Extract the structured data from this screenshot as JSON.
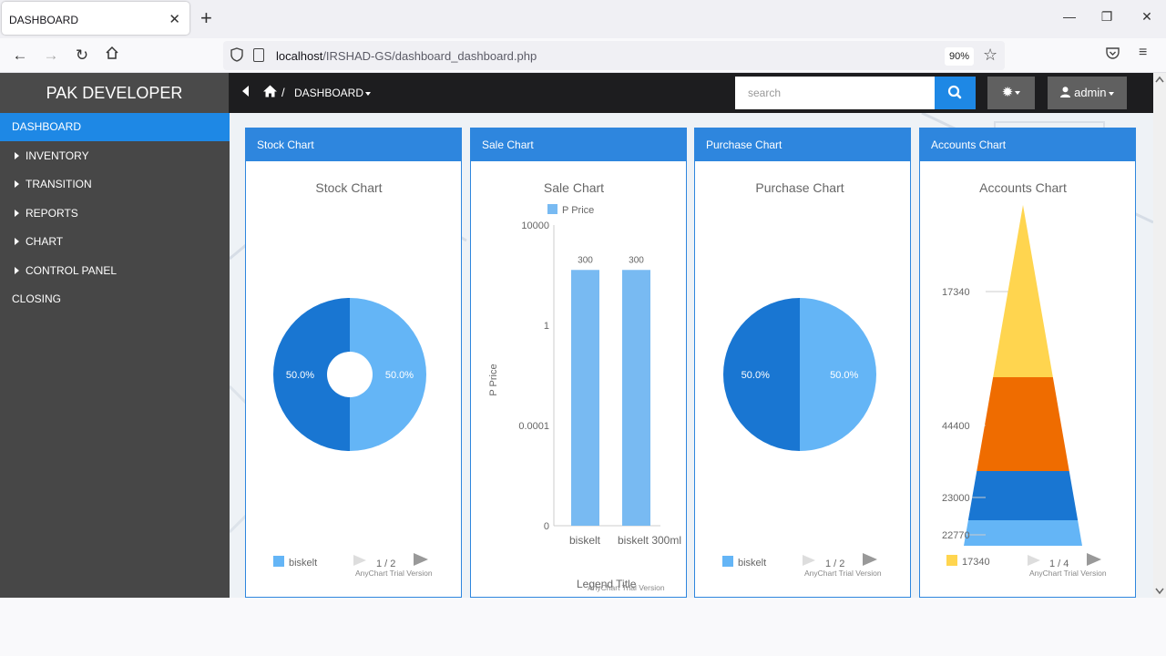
{
  "browser": {
    "tab_title": "DASHBOARD",
    "url_host": "localhost",
    "url_path": "/IRSHAD-GS/dashboard_dashboard.php",
    "zoom": "90%"
  },
  "header": {
    "brand": "PAK DEVELOPER",
    "breadcrumb_sep": "/",
    "breadcrumb": "DASHBOARD",
    "search_placeholder": "search",
    "user": "admin"
  },
  "sidebar": {
    "items": [
      {
        "label": "DASHBOARD",
        "active": true,
        "expandable": false
      },
      {
        "label": "INVENTORY",
        "active": false,
        "expandable": true
      },
      {
        "label": "TRANSITION",
        "active": false,
        "expandable": true
      },
      {
        "label": "REPORTS",
        "active": false,
        "expandable": true
      },
      {
        "label": "CHART",
        "active": false,
        "expandable": true
      },
      {
        "label": "CONTROL PANEL",
        "active": false,
        "expandable": true
      },
      {
        "label": "CLOSING",
        "active": false,
        "expandable": false
      }
    ]
  },
  "cards": {
    "stock": {
      "header": "Stock Chart",
      "title": "Stock Chart",
      "legend": "biskelt",
      "pager": "1 / 2",
      "watermark": "AnyChart Trial Version"
    },
    "sale": {
      "header": "Sale Chart",
      "title": "Sale Chart",
      "legend": "P Price",
      "ylabel": "P Price",
      "legend_title": "Legend Title",
      "watermark": "AnyChart Trial Version"
    },
    "purchase": {
      "header": "Purchase Chart",
      "title": "Purchase Chart",
      "legend": "biskelt",
      "pager": "1 / 2",
      "watermark": "AnyChart Trial Version"
    },
    "accounts": {
      "header": "Accounts Chart",
      "title": "Accounts Chart",
      "legend": "17340",
      "pager": "1 / 4",
      "watermark": "AnyChart Trial Version"
    }
  },
  "chart_data": [
    {
      "type": "pie",
      "title": "Stock Chart",
      "donut": true,
      "slices": [
        {
          "label": "50.0%",
          "value": 50,
          "color": "#64b5f6"
        },
        {
          "label": "50.0%",
          "value": 50,
          "color": "#1976d2"
        }
      ],
      "legend": [
        "biskelt"
      ]
    },
    {
      "type": "bar",
      "title": "Sale Chart",
      "ylabel": "P Price",
      "ticks": [
        "10000",
        "1",
        "0.0001",
        "0"
      ],
      "yscale": "log",
      "categories": [
        "biskelt",
        "biskelt 300ml"
      ],
      "series": [
        {
          "name": "P Price",
          "values": [
            300,
            300
          ],
          "labels": [
            "300",
            "300"
          ],
          "color": "#78baf2"
        }
      ]
    },
    {
      "type": "pie",
      "title": "Purchase Chart",
      "donut": false,
      "slices": [
        {
          "label": "50.0%",
          "value": 50,
          "color": "#64b5f6"
        },
        {
          "label": "50.0%",
          "value": 50,
          "color": "#1976d2"
        }
      ],
      "legend": [
        "biskelt"
      ]
    },
    {
      "type": "pyramid",
      "title": "Accounts Chart",
      "levels": [
        {
          "label": "17340",
          "value": 17340,
          "color": "#ffd54f"
        },
        {
          "label": "44400",
          "value": 44400,
          "color": "#ef6c00"
        },
        {
          "label": "23000",
          "value": 23000,
          "color": "#1976d2"
        },
        {
          "label": "22770",
          "value": 22770,
          "color": "#64b5f6"
        }
      ]
    }
  ]
}
